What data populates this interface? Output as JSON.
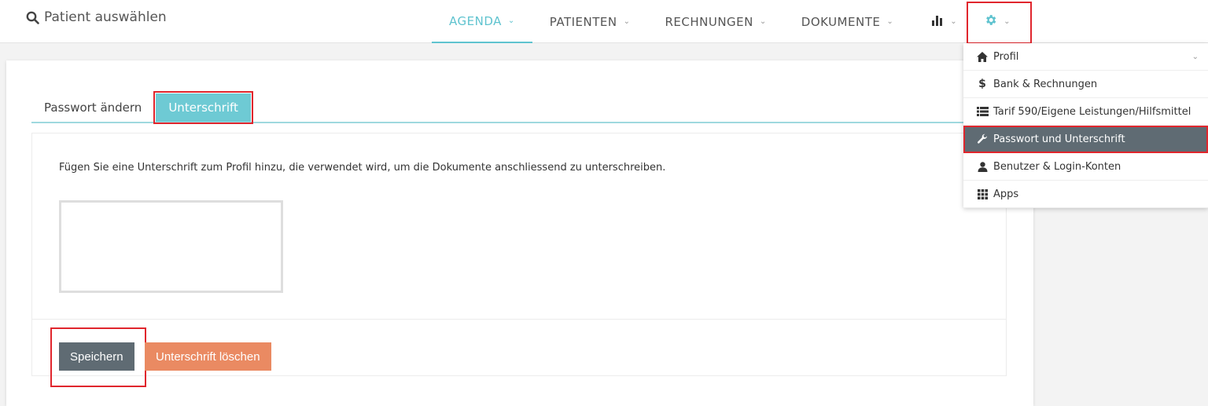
{
  "header": {
    "search_label": "Patient auswählen",
    "nav": [
      {
        "label": "AGENDA",
        "active": true
      },
      {
        "label": "PATIENTEN"
      },
      {
        "label": "RECHNUNGEN"
      },
      {
        "label": "DOKUMENTE"
      }
    ],
    "stats_icon": "bar-chart-icon",
    "settings_icon": "gear-icon",
    "chevron": "⌄"
  },
  "tabs": [
    {
      "label": "Passwort ändern"
    },
    {
      "label": "Unterschrift",
      "active": true
    }
  ],
  "panel": {
    "description": "Fügen Sie eine Unterschrift zum Profil hinzu, die verwendet wird, um die Dokumente anschliessend zu unterschreiben."
  },
  "buttons": {
    "save": "Speichern",
    "delete": "Unterschrift löschen"
  },
  "dropdown": {
    "items": [
      {
        "label": "Profil",
        "icon": "home-icon"
      },
      {
        "label": "Bank & Rechnungen",
        "icon": "dollar-icon"
      },
      {
        "label": "Tarif 590/Eigene Leistungen/Hilfsmittel",
        "icon": "list-icon"
      },
      {
        "label": "Passwort und Unterschrift",
        "icon": "wrench-icon",
        "active": true
      },
      {
        "label": "Benutzer & Login-Konten",
        "icon": "user-icon"
      },
      {
        "label": "Apps",
        "icon": "grid-icon"
      }
    ]
  },
  "colors": {
    "accent": "#5fc3cf",
    "highlight": "#e0262d",
    "save_button": "#5f6b73",
    "delete_button": "#ea8a62"
  }
}
